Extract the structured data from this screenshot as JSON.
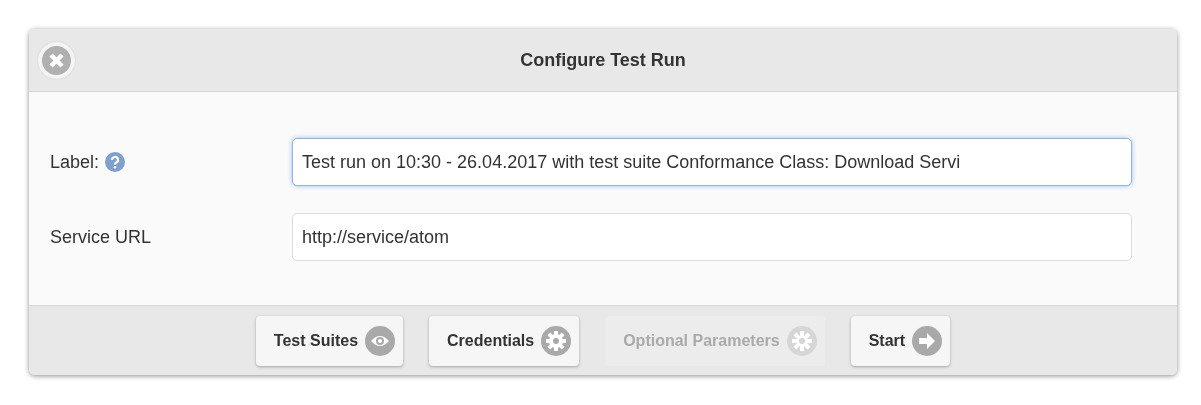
{
  "dialog": {
    "title": "Configure Test Run",
    "fields": [
      {
        "label": "Label:",
        "help": true,
        "value": "Test run on 10:30 - 26.04.2017 with test suite Conformance Class: Download Servi",
        "focused": true
      },
      {
        "label": "Service URL",
        "help": false,
        "value": "http://service/atom",
        "focused": false
      }
    ],
    "buttons": [
      {
        "label": "Test Suites",
        "kind": "eye",
        "disabled": false
      },
      {
        "label": "Credentials",
        "kind": "gear",
        "disabled": false
      },
      {
        "label": "Optional Parameters",
        "kind": "gear",
        "disabled": true
      },
      {
        "label": "Start",
        "kind": "arrow",
        "disabled": false
      }
    ]
  }
}
